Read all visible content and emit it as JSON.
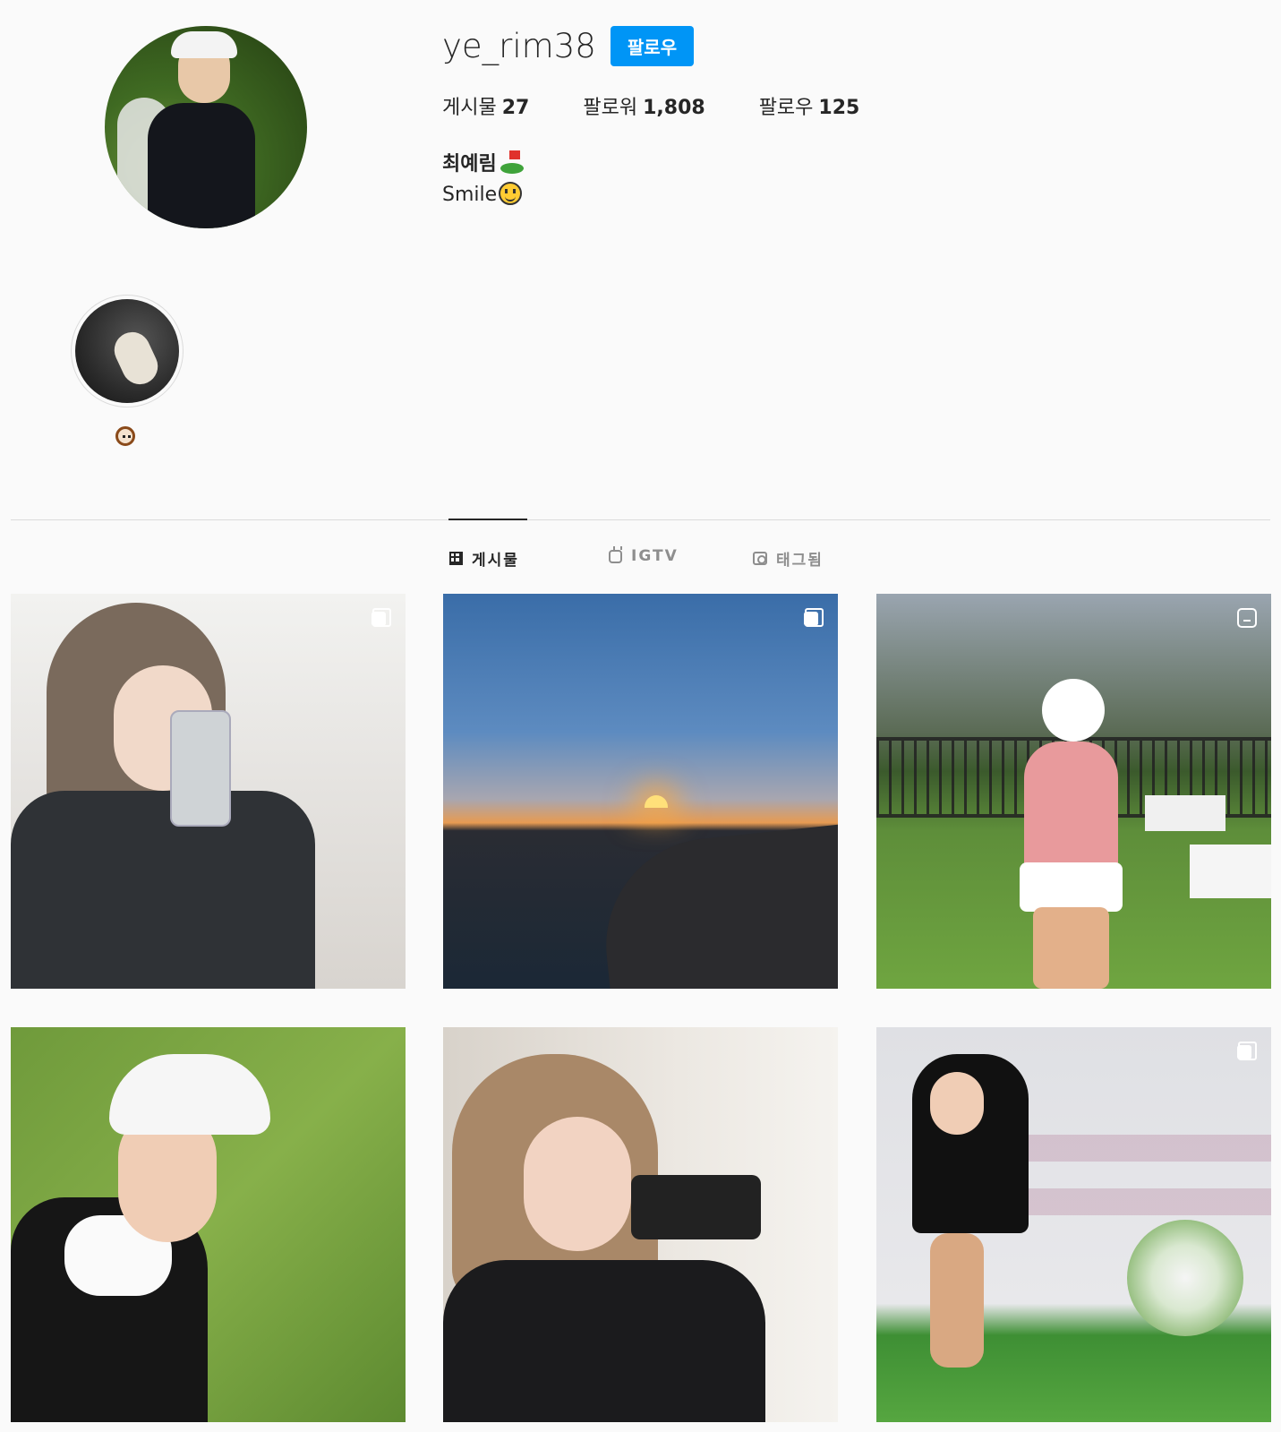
{
  "profile": {
    "username": "ye_rim38",
    "follow_label": "팔로우",
    "stats": {
      "posts_label": "게시물",
      "posts_count": "27",
      "followers_label": "팔로워",
      "followers_count": "1,808",
      "following_label": "팔로우",
      "following_count": "125"
    },
    "full_name": "최예림",
    "bio": "Smile"
  },
  "highlights": [
    {
      "icon": "dog-face-emoji"
    }
  ],
  "tabs": [
    {
      "label": "게시물",
      "icon": "grid-icon",
      "active": true
    },
    {
      "label": "IGTV",
      "icon": "igtv-icon",
      "active": false
    },
    {
      "label": "태그됨",
      "icon": "tagged-icon",
      "active": false
    }
  ],
  "posts": [
    {
      "badge": "carousel-icon"
    },
    {
      "badge": "carousel-icon"
    },
    {
      "badge": "clip-icon"
    },
    {
      "badge": ""
    },
    {
      "badge": ""
    },
    {
      "badge": "carousel-icon"
    }
  ],
  "colors": {
    "background": "#fafafa",
    "accent": "#0095f6",
    "text": "#262626",
    "muted": "#8e8e8e",
    "divider": "#dbdbdb"
  }
}
